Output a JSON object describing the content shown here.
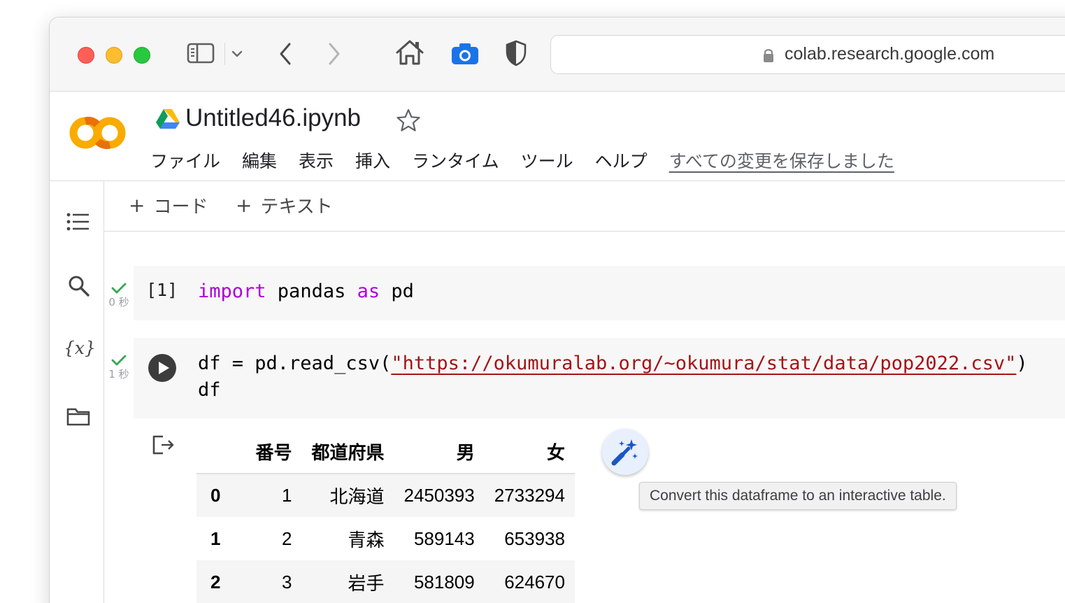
{
  "browser": {
    "url": "colab.research.google.com",
    "icons": [
      "sidebar-icon",
      "chevron-down-icon",
      "back-arrow-icon",
      "forward-arrow-icon",
      "home-icon",
      "camera-icon",
      "shield-icon",
      "lock-icon"
    ]
  },
  "notebook": {
    "title": "Untitled46.ipynb",
    "menu": [
      "ファイル",
      "編集",
      "表示",
      "挿入",
      "ランタイム",
      "ツール",
      "ヘルプ"
    ],
    "save_status": "すべての変更を保存しました"
  },
  "rail": {
    "variables_icon": "{x}"
  },
  "toolbar": {
    "add_code": "コード",
    "add_text": "テキスト",
    "plus": "+"
  },
  "cells": [
    {
      "prompt": "[1]",
      "time": "0 秒",
      "code": {
        "kw1": "import",
        "t1": " pandas ",
        "kw2": "as",
        "t2": " pd"
      }
    },
    {
      "time": "1 秒",
      "code": {
        "line1_pre": "df = pd.read_csv(",
        "q1": "\"",
        "url": "https://okumuralab.org/~okumura/stat/data/pop2022.csv",
        "q2": "\"",
        "line1_post": ")",
        "line2": "df"
      }
    }
  ],
  "output": {
    "columns": [
      "",
      "番号",
      "都道府県",
      "男",
      "女"
    ],
    "rows": [
      [
        "0",
        "1",
        "北海道",
        "2450393",
        "2733294"
      ],
      [
        "1",
        "2",
        "青森",
        "589143",
        "653938"
      ],
      [
        "2",
        "3",
        "岩手",
        "581809",
        "624670"
      ]
    ],
    "tooltip": "Convert this dataframe to an interactive table."
  },
  "colors": {
    "keyword": "#af00db",
    "string": "#a31515",
    "check": "#34a853",
    "colab_orange": "#f9ab00",
    "colab_dark_orange": "#e8710a"
  }
}
